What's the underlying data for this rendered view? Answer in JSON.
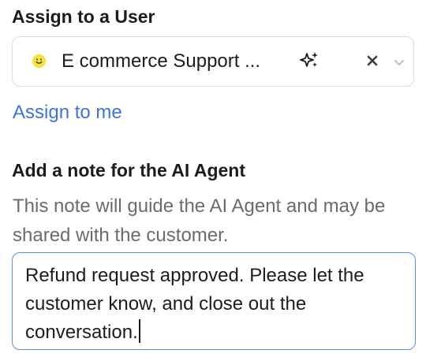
{
  "assign": {
    "title": "Assign to a User",
    "selected_user": "E commerce Support ...",
    "avatar_icon": "smiley-face-icon",
    "avatar_color": "#f6e03a",
    "ai_icon": "sparkle-icon",
    "clear_icon": "close-x-icon",
    "dropdown_icon": "chevron-down-icon",
    "assign_to_me_label": "Assign to me",
    "link_color": "#3d74d9"
  },
  "note": {
    "title": "Add a note for the AI Agent",
    "help_text": "This note will guide the AI Agent and may be shared with the customer.",
    "value": "Refund request approved. Please let the customer know, and close out the conversation.",
    "focus_border_color": "#5f8fd8"
  }
}
